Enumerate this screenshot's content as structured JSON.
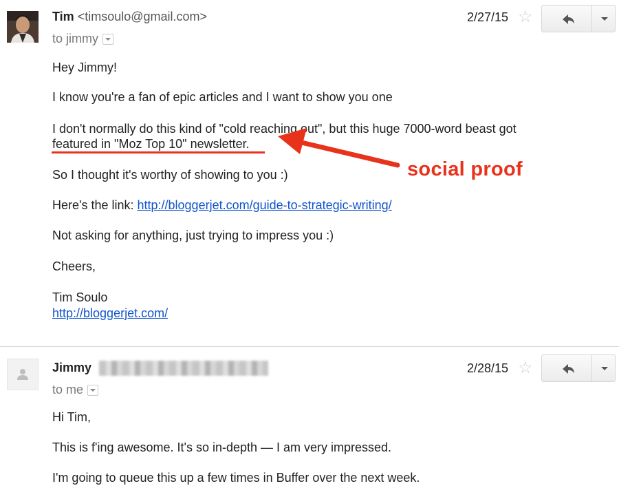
{
  "message1": {
    "sender_name": "Tim",
    "sender_email": "<timsoulo@gmail.com>",
    "recipient": "to jimmy",
    "date": "2/27/15",
    "lines": {
      "greeting": "Hey Jimmy!",
      "p1": "I know you're a fan of epic articles and I want to show you one",
      "p2a": "I don't normally do this kind of \"cold reaching out\", but this huge 7000-word beast got",
      "p2b": "featured in \"Moz Top 10\" newsletter.",
      "p3": "So I thought it's worthy of showing to you :)",
      "p4_prefix": "Here's the link: ",
      "p4_link": "http://bloggerjet.com/guide-to-strategic-writing/",
      "p5": "Not asking for anything, just trying to impress you :)",
      "p6": "Cheers,",
      "sig_name": "Tim Soulo",
      "sig_link": "http://bloggerjet.com/"
    }
  },
  "annotation": {
    "text": "social proof",
    "color": "#e8321c"
  },
  "message2": {
    "sender_name": "Jimmy",
    "recipient": "to me",
    "date": "2/28/15",
    "lines": {
      "greeting": "Hi Tim,",
      "p1": "This is f'ing awesome. It's so in-depth — I am very impressed.",
      "p2": "I'm going to queue this up a few times in Buffer over the next week."
    }
  },
  "icons": {
    "star": "star-outline-icon",
    "reply": "reply-arrow-icon",
    "more": "chevron-down-icon",
    "avatar_placeholder": "person-silhouette-icon"
  },
  "colors": {
    "link": "#1155cc",
    "annotation": "#e8321c"
  }
}
